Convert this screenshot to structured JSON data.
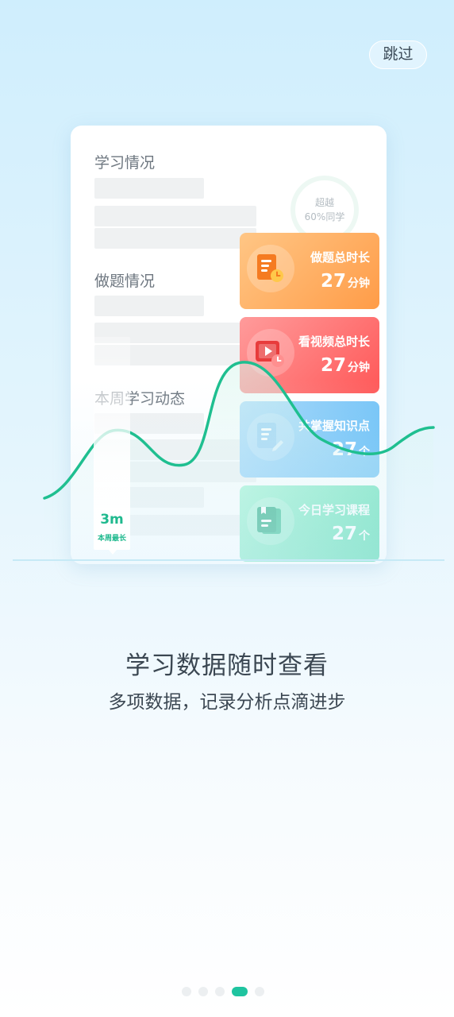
{
  "skip_label": "跳过",
  "card": {
    "section_study": "学习情况",
    "section_practice": "做题情况",
    "section_weekly": "本周学习动态",
    "ring_line1": "超越",
    "ring_line2": "60%同学"
  },
  "tiles": [
    {
      "label": "做题总时长",
      "value": "27",
      "unit": "分钟",
      "icon": "document-clock-icon"
    },
    {
      "label": "看视频总时长",
      "value": "27",
      "unit": "分钟",
      "icon": "video-clock-icon"
    },
    {
      "label": "共掌握知识点",
      "value": "27",
      "unit": "个",
      "icon": "document-pen-icon"
    },
    {
      "label": "今日学习课程",
      "value": "27",
      "unit": "个",
      "icon": "book-icon"
    }
  ],
  "chart_marker": {
    "value": "3m",
    "caption": "本周最长"
  },
  "headline": "学习数据随时查看",
  "subline": "多项数据，记录分析点滴进步",
  "pagination": {
    "count": 5,
    "active_index": 3
  },
  "colors": {
    "accent_green": "#1fc4a0",
    "curve": "#1fbf90",
    "tile_orange": "#ff9c48",
    "tile_red": "#ff5858",
    "tile_blue": "#57b8f4",
    "tile_green": "#33d39f"
  }
}
